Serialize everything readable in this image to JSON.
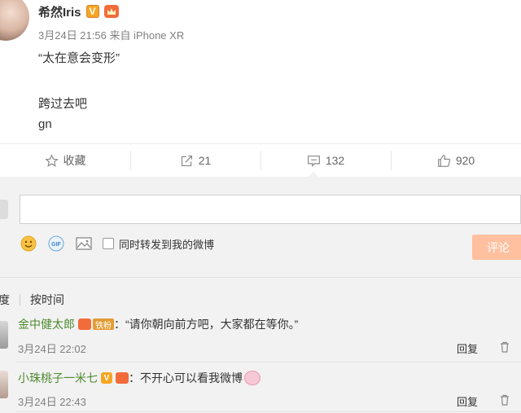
{
  "post": {
    "author": "希然Iris",
    "badge_v": "V",
    "meta": "3月24日 21:56 来自 iPhone XR",
    "lines": [
      "“太在意会变形”",
      "跨过去吧",
      "gn"
    ]
  },
  "actions": {
    "favorite": {
      "label": "收藏",
      "icon": "star-icon"
    },
    "repost": {
      "label": "21",
      "icon": "share-icon"
    },
    "comment": {
      "label": "132",
      "icon": "comment-icon"
    },
    "like": {
      "label": "920",
      "icon": "thumbs-up-icon"
    }
  },
  "composer": {
    "input_value": "",
    "also_repost_label": "同时转发到我的微博",
    "submit_label": "评论",
    "tools": [
      "smiley-icon",
      "gif-icon",
      "image-icon"
    ],
    "gif_text": "GIF"
  },
  "sort": {
    "hot_fragment": "度",
    "by_time": "按时间"
  },
  "comments": [
    {
      "user": "金中健太郎",
      "fan_badge": "铁粉",
      "text": "：“请你朝向前方吧，大家都在等你。”",
      "time": "3月24日 22:02",
      "reply": "回复"
    },
    {
      "user": "小珠桃子一米七",
      "badge_v": "V",
      "text": "：不开心可以看我微博",
      "time": "3月24日 22:43",
      "reply": "回复"
    }
  ],
  "colors": {
    "accent_orange": "#ffc09f",
    "username_green": "#4f8a2f",
    "panel_gray": "#f2f2f2"
  }
}
